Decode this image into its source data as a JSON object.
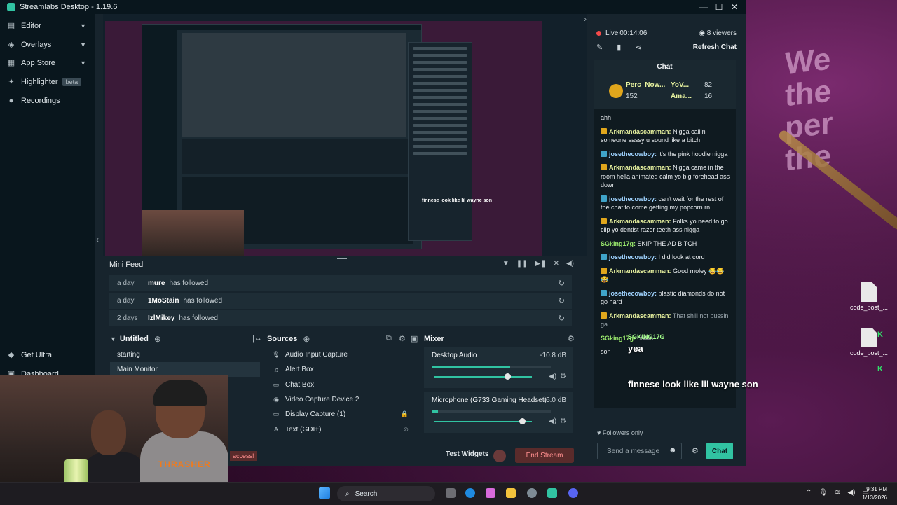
{
  "window": {
    "title": "Streamlabs Desktop - 1.19.6",
    "controls": [
      "—",
      "☐",
      "✕"
    ]
  },
  "sidebar": {
    "items": [
      {
        "label": "Editor",
        "icon": "editor-icon"
      },
      {
        "label": "Overlays",
        "icon": "overlays-icon"
      },
      {
        "label": "App Store",
        "icon": "app-store-icon"
      },
      {
        "label": "Highlighter",
        "icon": "highlighter-icon",
        "badge": "beta"
      },
      {
        "label": "Recordings",
        "icon": "recordings-icon"
      }
    ],
    "bottom": [
      {
        "label": "Get Ultra",
        "icon": "ultra-icon"
      },
      {
        "label": "Dashboard",
        "icon": "dashboard-icon"
      }
    ]
  },
  "minifeed": {
    "title": "Mini Feed",
    "rows": [
      {
        "time": "a day",
        "user": "mure",
        "action": "has followed"
      },
      {
        "time": "a day",
        "user": "1MoStain",
        "action": "has followed"
      },
      {
        "time": "2 days",
        "user": "IzlMikey",
        "action": "has followed"
      }
    ]
  },
  "scenes": {
    "title": "Untitled",
    "items": [
      "starting",
      "Main Monitor"
    ],
    "selected": 1
  },
  "sources": {
    "title": "Sources",
    "items": [
      {
        "label": "Audio Input Capture",
        "icon": "microphone-icon"
      },
      {
        "label": "Alert Box",
        "icon": "bell-icon"
      },
      {
        "label": "Chat Box",
        "icon": "chat-icon"
      },
      {
        "label": "Video Capture Device 2",
        "icon": "camera-icon"
      },
      {
        "label": "Display Capture (1)",
        "icon": "monitor-icon"
      },
      {
        "label": "Text (GDI+)",
        "icon": "text-icon"
      }
    ]
  },
  "mixer": {
    "title": "Mixer",
    "channels": [
      {
        "name": "Desktop Audio",
        "db": "-10.8 dB",
        "level": 0.66,
        "volume": 0.75
      },
      {
        "name": "Microphone (G733 Gaming Headset)",
        "db": "-5.0 dB",
        "level": 0.05,
        "volume": 0.9
      }
    ]
  },
  "footer": {
    "test_widgets": "Test Widgets",
    "end_stream": "End Stream",
    "access_text": "access!"
  },
  "live": {
    "status": "Live",
    "timer": "00:14:06",
    "viewers": "8 viewers",
    "refresh": "Refresh Chat"
  },
  "chat": {
    "title": "Chat",
    "leaders": [
      {
        "name": "Perc_Now...",
        "count": "152"
      },
      {
        "name": "YoV...",
        "count": "82"
      },
      {
        "name": "Ama...",
        "count": "16"
      }
    ],
    "messages": [
      {
        "user": "",
        "text": "ahh"
      },
      {
        "user": "Arkmandascamman:",
        "text": "Nigga callin someone sassy u sound like a bitch",
        "color": "yellow"
      },
      {
        "user": "josethecowboy:",
        "text": "it's the pink hoodie nigga",
        "color": "blue"
      },
      {
        "user": "Arkmandascamman:",
        "text": "Nigga came in the room hella animated calm yo big forehead ass down",
        "color": "yellow"
      },
      {
        "user": "josethecowboy:",
        "text": "can't wait for the rest of the chat to come getting my popcorn rn",
        "color": "blue"
      },
      {
        "user": "Arkmandascamman:",
        "text": "Folks yo need to go clip yo dentist razor teeth ass nigga",
        "color": "yellow"
      },
      {
        "user": "SGking17g:",
        "text": "SKIP THE AD BITCH",
        "color": "green"
      },
      {
        "user": "josethecowboy:",
        "text": "I did look at cord",
        "color": "blue"
      },
      {
        "user": "Arkmandascamman:",
        "text": "Good moley 😂😂😂",
        "color": "yellow"
      },
      {
        "user": "josethecowboy:",
        "text": "plastic diamonds do not go hard",
        "color": "blue"
      },
      {
        "user": "Arkmandascamman:",
        "text": "That shill not bussin ga",
        "color": "yellow"
      },
      {
        "user": "SGking17g:",
        "text": "chillin",
        "color": "green"
      },
      {
        "user": "",
        "text": "son"
      }
    ],
    "followers_only": "Followers only",
    "input_placeholder": "Send a message",
    "send": "Chat"
  },
  "overlay": {
    "name": "SGKING17G",
    "msg1": "yea",
    "msg2": "finnese look like lil wayne son"
  },
  "desktop": {
    "file1": "code_post_...",
    "file2": "code_post_...",
    "wall_text": "We\nthe\nper\nthe"
  },
  "taskbar": {
    "search": "Search",
    "time": "9:31 PM",
    "date": "1/13/2026"
  },
  "colors": {
    "accent": "#31c3a2",
    "live": "#f44a4a",
    "sidebar": "#09161d",
    "panel": "#17242d"
  }
}
